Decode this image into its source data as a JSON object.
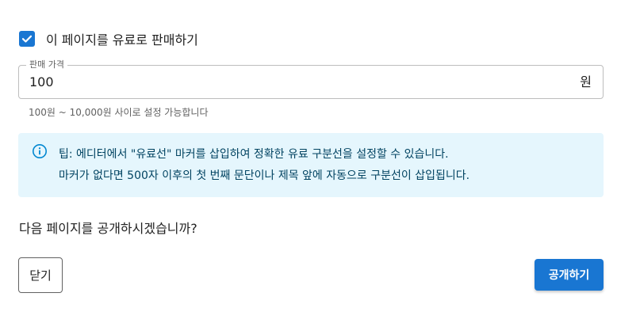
{
  "paid_option": {
    "checked": true,
    "label": "이 페이지를 유료로 판매하기"
  },
  "price_field": {
    "legend": "판매 가격",
    "value": "100",
    "unit": "원",
    "helper": "100원 ~ 10,000원 사이로 설정 가능합니다"
  },
  "tip": {
    "icon": "info-icon",
    "line1": "팁: 에디터에서 \"유료선\" 마커를 삽입하여 정확한 유료 구분선을 설정할 수 있습니다.",
    "line2": "마커가 없다면 500자 이후의 첫 번째 문단이나 제목 앞에 자동으로 구분선이 삽입됩니다."
  },
  "question": "다음 페이지를 공개하시겠습니까?",
  "buttons": {
    "close": "닫기",
    "publish": "공개하기"
  },
  "colors": {
    "primary": "#1976d2",
    "info_bg": "#e5f6fd",
    "info_text": "#014361",
    "info_icon": "#0288d1"
  }
}
